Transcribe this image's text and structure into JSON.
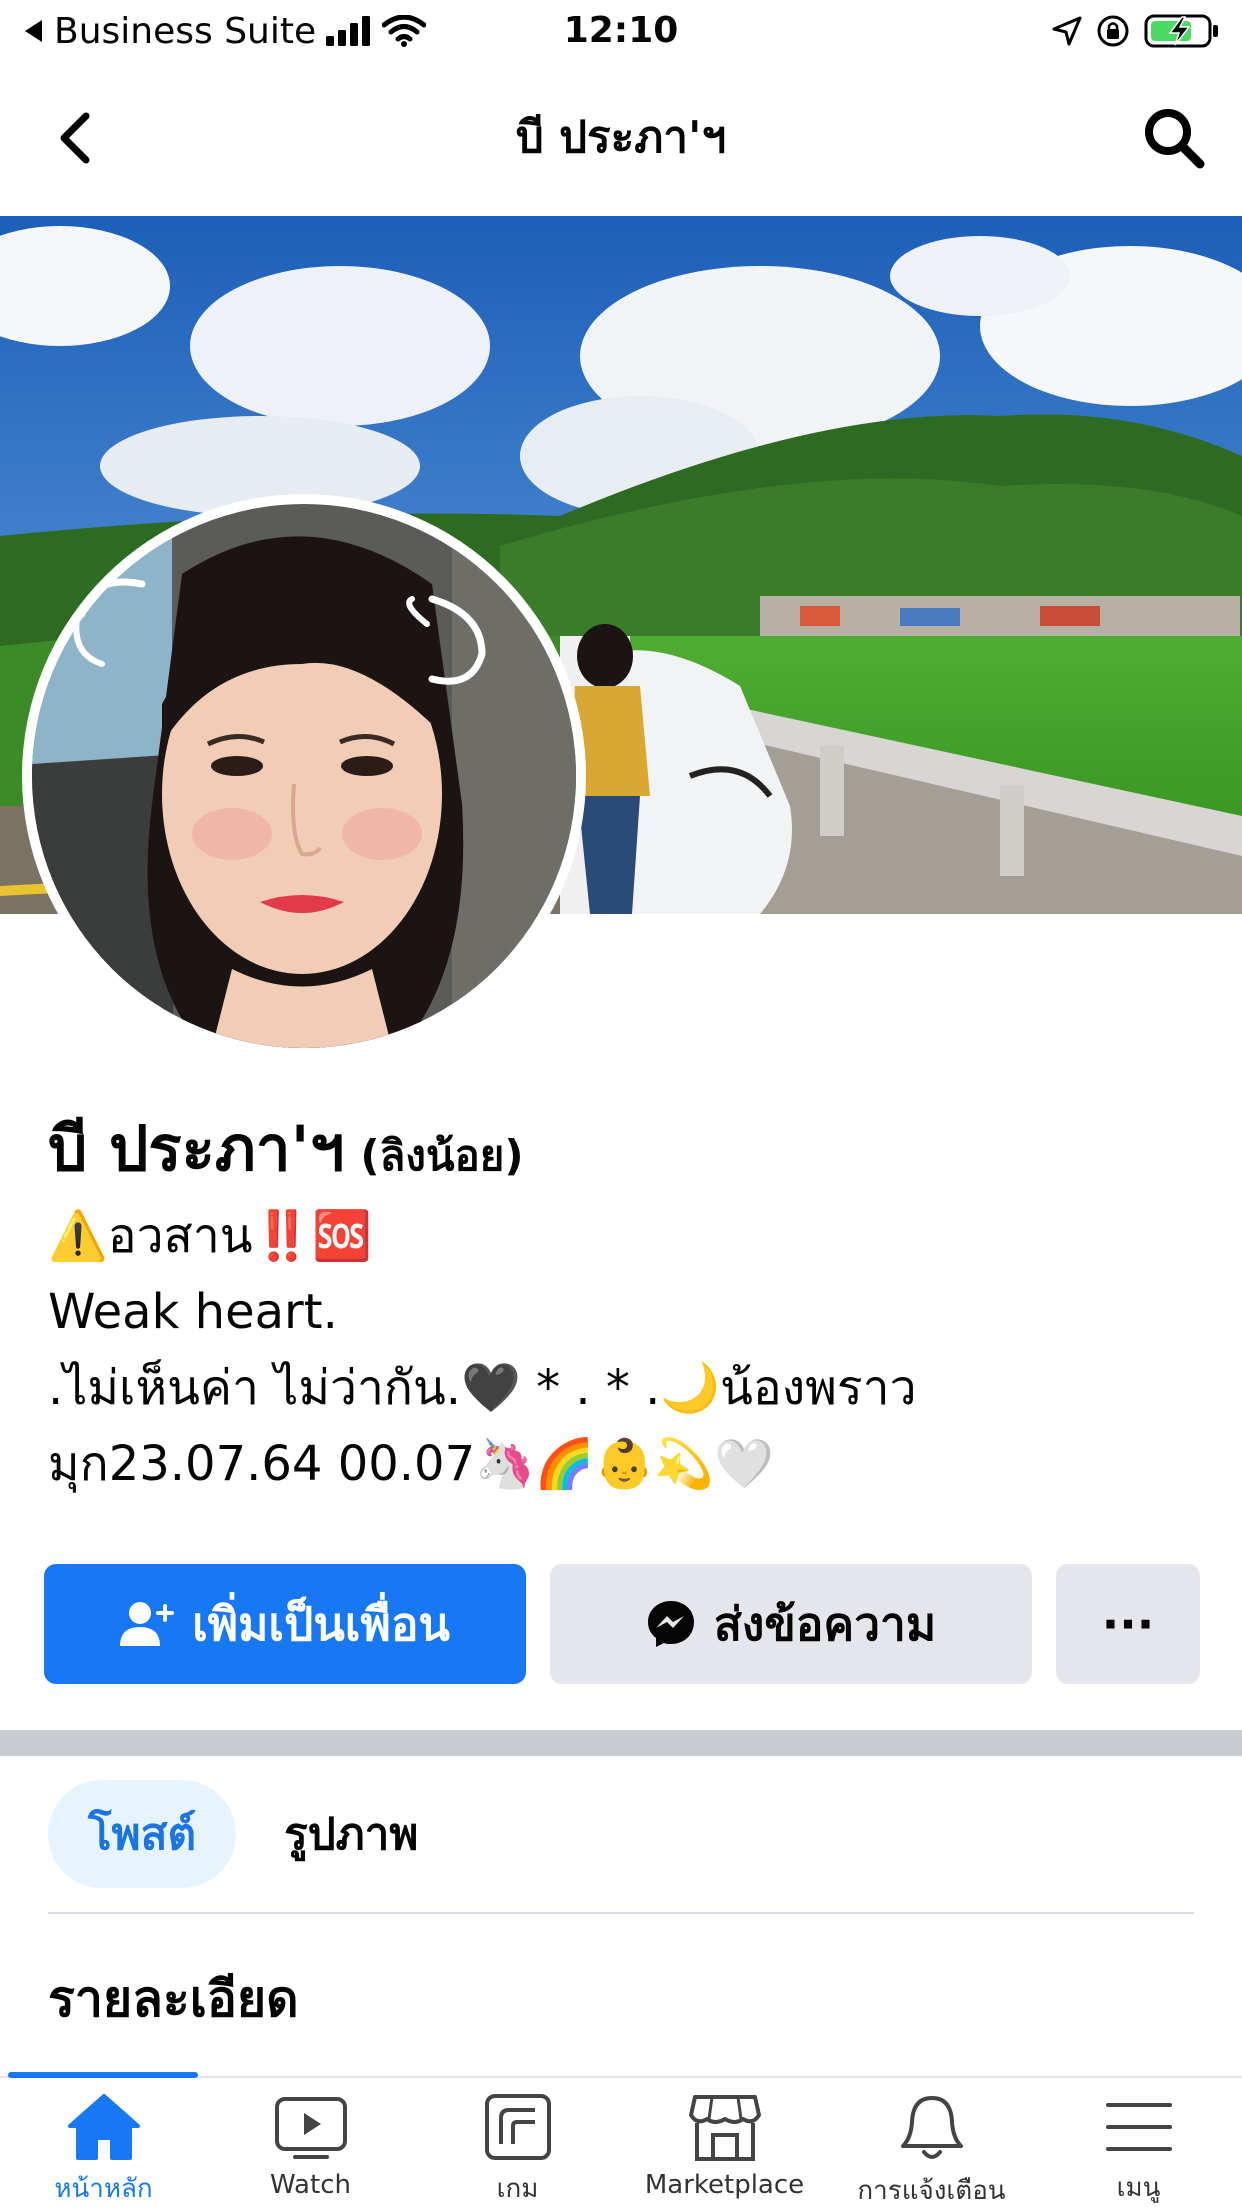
{
  "status_bar": {
    "back_app": "Business Suite",
    "time": "12:10"
  },
  "nav": {
    "title": "บี ประภา'ฯ"
  },
  "profile": {
    "name": "บี ประภา'ฯ",
    "alternate_name": "(ลิงน้อย)",
    "bio_lines": [
      "⚠️อวสาน‼️🆘",
      "Weak heart.",
      " .ไม่เห็นค่า ไม่ว่ากัน.🖤  *  .  * .🌙น้องพราว",
      "มุก23.07.64  00.07🦄🌈👶💫🤍"
    ]
  },
  "actions": {
    "add_friend": "เพิ่มเป็นเพื่อน",
    "message": "ส่งข้อความ",
    "more": "···"
  },
  "tabs": [
    {
      "label": "โพสต์"
    },
    {
      "label": "รูปภาพ"
    }
  ],
  "details": {
    "title": "รายละเอียด"
  },
  "bottom_tabs": [
    {
      "label": "หน้าหลัก",
      "icon": "home-icon"
    },
    {
      "label": "Watch",
      "icon": "watch-icon"
    },
    {
      "label": "เกม",
      "icon": "gaming-icon"
    },
    {
      "label": "Marketplace",
      "icon": "marketplace-icon"
    },
    {
      "label": "การแจ้งเตือน",
      "icon": "bell-icon"
    },
    {
      "label": "เมนู",
      "icon": "menu-icon"
    }
  ],
  "colors": {
    "accent": "#1877f2",
    "secondary_button": "#e4e6eb",
    "tab_active_bg": "#e7f3ff"
  }
}
